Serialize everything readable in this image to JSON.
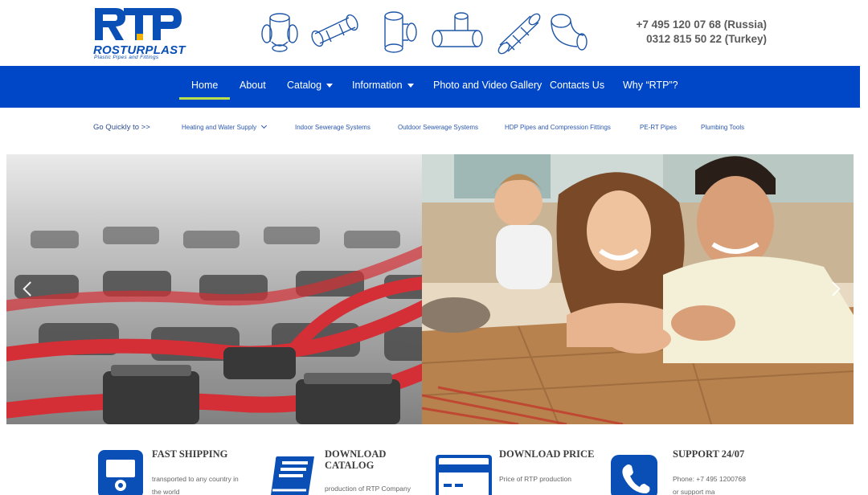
{
  "brand": {
    "name": "ROSTURPLAST",
    "tagline": "Plastic Pipes and Fittings",
    "monogram": "RTP",
    "colors": {
      "blue": "#0a4fb5",
      "accent": "#f0b400"
    }
  },
  "header": {
    "phones": [
      "+7 495 120 07 68 (Russia)",
      "0312 815 50 22 (Turkey)"
    ]
  },
  "nav": {
    "items": [
      {
        "label": "Home",
        "active": true,
        "dropdown": false
      },
      {
        "label": "About",
        "active": false,
        "dropdown": false
      },
      {
        "label": "Catalog",
        "active": false,
        "dropdown": true
      },
      {
        "label": "Information",
        "active": false,
        "dropdown": true
      },
      {
        "label": "Photo and Video Gallery",
        "active": false,
        "dropdown": false
      },
      {
        "label": "Contacts Us",
        "active": false,
        "dropdown": false
      },
      {
        "label": "Why “RTP”?",
        "active": false,
        "dropdown": false
      }
    ],
    "colors": {
      "background": "#0047c8",
      "active_underline": "#b9e04a"
    }
  },
  "quick": {
    "label": "Go Quickly to >>",
    "links": [
      {
        "label": "Heating and Water Supply",
        "dropdown": true
      },
      {
        "label": "Indoor Sewerage Systems",
        "dropdown": false
      },
      {
        "label": "Outdoor Sewerage Systems",
        "dropdown": false
      },
      {
        "label": "HDP Pipes and Compression Fittings",
        "dropdown": false
      },
      {
        "label": "PE-RT Pipes",
        "dropdown": false
      },
      {
        "label": "Plumbing Tools",
        "dropdown": false
      }
    ]
  },
  "slider": {
    "left_image": "underfloor-heating-pipes-photo",
    "right_image": "family-on-floor-photo"
  },
  "features": [
    {
      "icon": "truck-icon",
      "title": "FAST SHIPPING",
      "text": [
        "transported to any country in",
        "the world"
      ]
    },
    {
      "icon": "book-icon",
      "title": "DOWNLOAD CATALOG",
      "text": [
        "production of RTP Company"
      ]
    },
    {
      "icon": "credit-card-icon",
      "title": "DOWNLOAD PRICE",
      "text": [
        "Price of RTP production"
      ]
    },
    {
      "icon": "phone-icon",
      "title": "SUPPORT 24/07",
      "text": [
        "Phone: +7 495 1200768",
        "or support ma"
      ]
    }
  ]
}
